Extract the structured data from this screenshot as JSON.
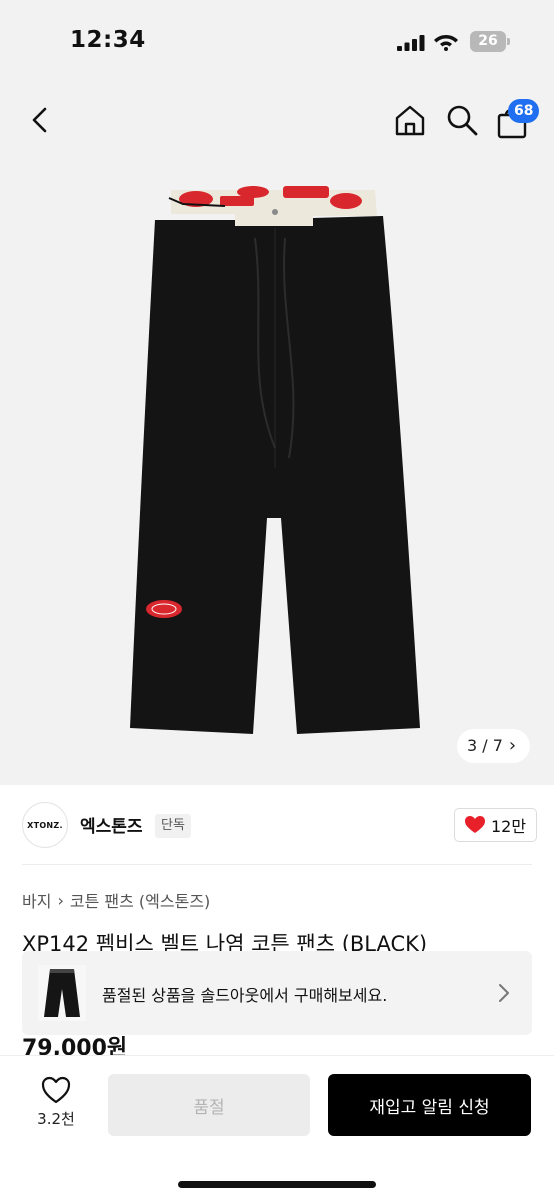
{
  "status_bar": {
    "time": "12:34",
    "battery": "26"
  },
  "nav": {
    "cart_count": "68"
  },
  "gallery": {
    "pager": "3 / 7",
    "pager_chevron": "›"
  },
  "brand": {
    "logo_text": "XTONZ.",
    "name": "엑스톤즈",
    "tag": "단독",
    "likes": "12만"
  },
  "breadcrumb": {
    "items": [
      "바지",
      "코튼 팬츠 (엑스톤즈)"
    ],
    "separator": "›"
  },
  "product": {
    "title": "XP142 펨비스 벨트 나염 코튼 팬츠 (BLACK)",
    "price": "79,000원"
  },
  "soldout_banner": {
    "text": "품절된 상품을 솔드아웃에서 구매해보세요."
  },
  "bottom_bar": {
    "wish_count": "3.2천",
    "soldout_label": "품절",
    "restock_label": "재입고 알림 신청"
  },
  "colors": {
    "accent_blue": "#1f6ff0",
    "heart_red": "#e8202a",
    "button_black": "#000000"
  }
}
